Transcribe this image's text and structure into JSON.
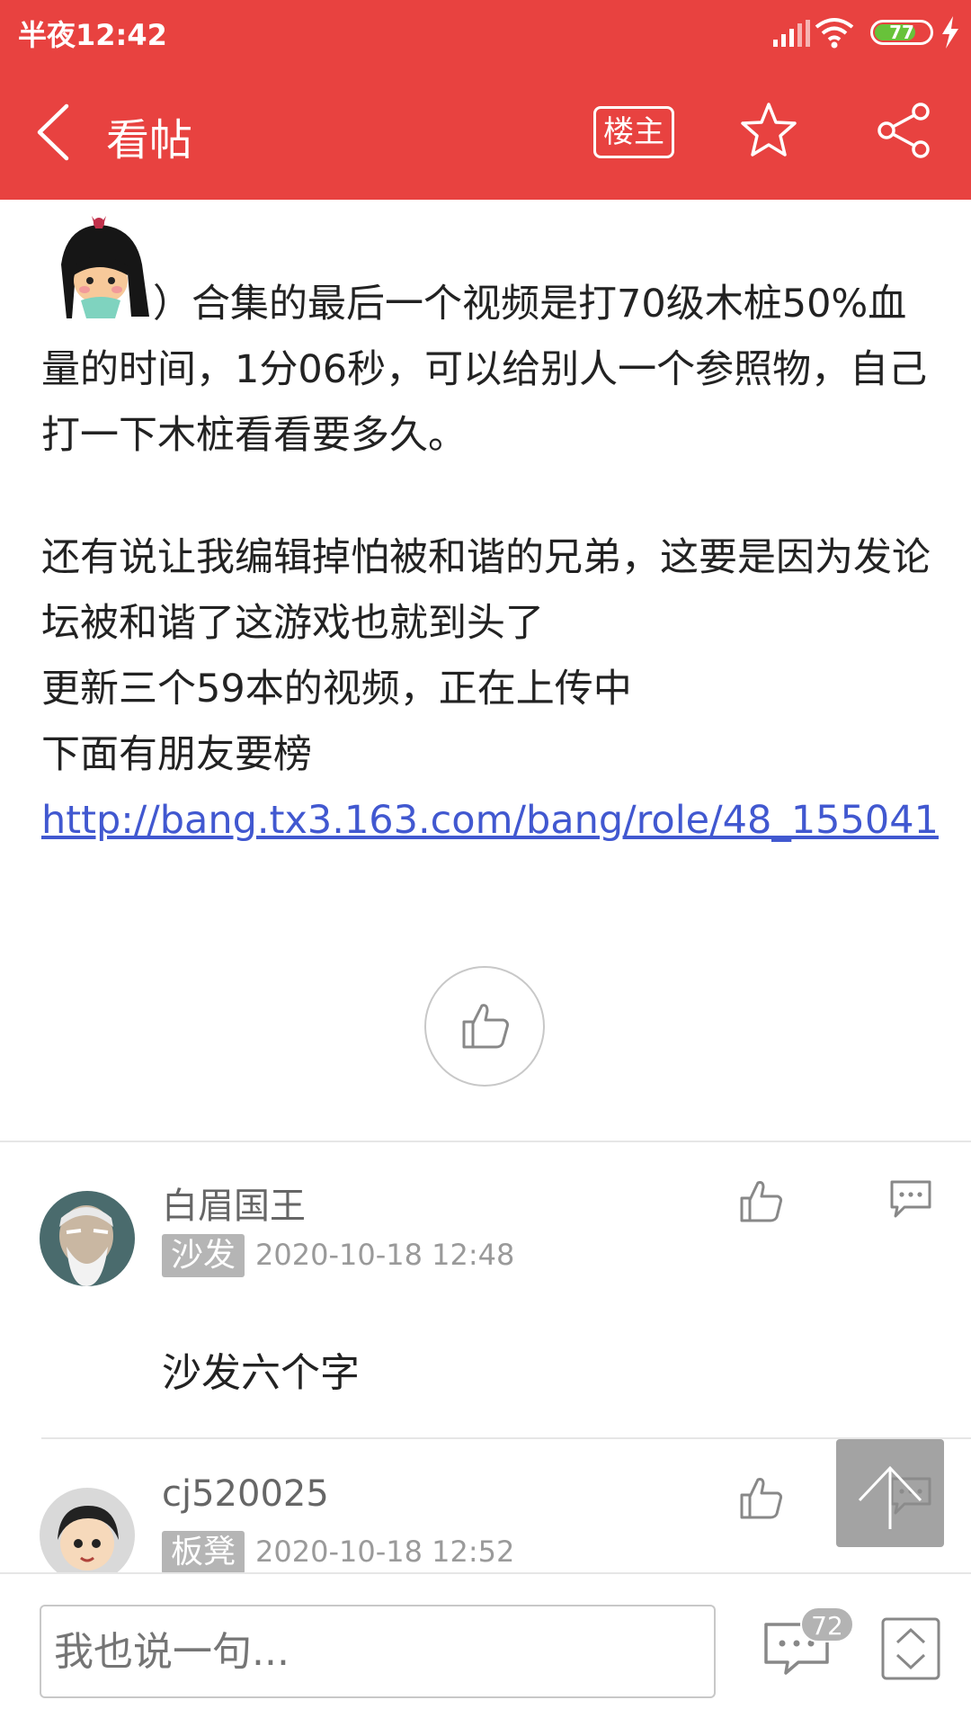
{
  "status_bar": {
    "time": "半夜12:42",
    "battery": "77",
    "battery_level": 0.77
  },
  "header": {
    "title": "看帖",
    "owner_label": "楼主",
    "icons": [
      "back-icon",
      "star-icon",
      "share-icon"
    ]
  },
  "post": {
    "para1": "）合集的最后一个视频是打70级木桩50%血量的时间，1分06秒，可以给别人一个参照物，自己打一下木桩看看要多久。",
    "line2": "还有说让我编辑掉怕被和谐的兄弟，这要是因为发论坛被和谐了这游戏也就到头了",
    "line3": "更新三个59本的视频，正在上传中",
    "line4": "下面有朋友要榜",
    "link": "http://bang.tx3.163.com/bang/role/48_155041"
  },
  "comments": [
    {
      "name": "白眉国王",
      "floor": "沙发",
      "time": "2020-10-18 12:48",
      "text": "沙发六个字"
    },
    {
      "name": "cj520025",
      "floor": "板凳",
      "time": "2020-10-18 12:52"
    }
  ],
  "bottom_bar": {
    "input_placeholder": "我也说一句...",
    "comment_count": "72"
  },
  "colors": {
    "brand_red": "#e84240",
    "link_blue": "#4158d0",
    "battery_green": "#68c23a"
  }
}
